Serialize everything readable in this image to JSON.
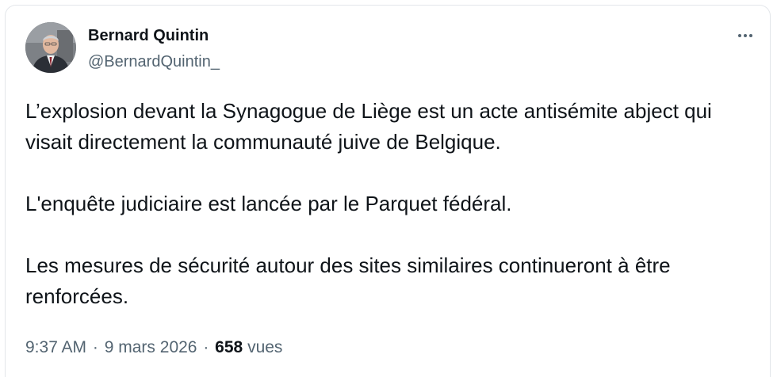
{
  "author": {
    "name": "Bernard Quintin",
    "handle": "@BernardQuintin_"
  },
  "tweet": {
    "paragraphs": [
      "L’explosion devant la Synagogue de Liège est un acte antisémite abject qui visait directement la communauté juive de Belgique.",
      "L'enquête judiciaire est lancée par le Parquet fédéral.",
      "Les mesures de sécurité autour des sites similaires continueront à être renforcées."
    ],
    "time": "9:37 AM",
    "date": "9 mars 2026",
    "separator": "·",
    "views_count": "658",
    "views_label": "vues"
  },
  "icons": {
    "more": "more-horizontal-icon",
    "avatar": "profile-photo"
  },
  "colors": {
    "text_primary": "#0f1419",
    "text_secondary": "#536471",
    "border": "#e3e6ea"
  }
}
